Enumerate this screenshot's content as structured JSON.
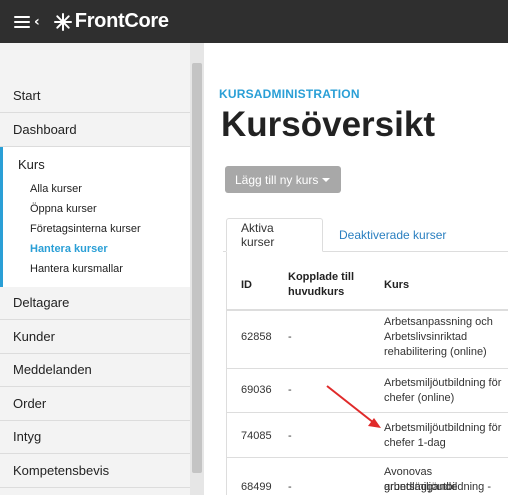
{
  "app": {
    "logo_text": "FrontCore"
  },
  "sidebar": {
    "items_top": [
      {
        "label": "Start"
      },
      {
        "label": "Dashboard"
      }
    ],
    "kurs": {
      "label": "Kurs",
      "subitems": [
        {
          "label": "Alla kurser"
        },
        {
          "label": "Öppna kurser"
        },
        {
          "label": "Företagsinterna kurser"
        },
        {
          "label": "Hantera kurser"
        },
        {
          "label": "Hantera kursmallar"
        }
      ]
    },
    "items_bottom": [
      {
        "label": "Deltagare"
      },
      {
        "label": "Kunder"
      },
      {
        "label": "Meddelanden"
      },
      {
        "label": "Order"
      },
      {
        "label": "Intyg"
      },
      {
        "label": "Kompetensbevis"
      }
    ]
  },
  "main": {
    "section_label": "KURSADMINISTRATION",
    "title": "Kursöversikt",
    "add_button": "Lägg till ny kurs",
    "tabs": [
      {
        "label": "Aktiva kurser"
      },
      {
        "label": "Deaktiverade kurser"
      }
    ],
    "table": {
      "headers": {
        "id": "ID",
        "linked_1": "Kopplade till",
        "linked_2": "huvudkurs",
        "course": "Kurs"
      },
      "rows": [
        {
          "id": "62858",
          "linked": "-",
          "course_1": "Arbetsanpassning och",
          "course_2": "Arbetslivsinriktad",
          "course_3": "rehabilitering (online)"
        },
        {
          "id": "69036",
          "linked": "-",
          "course_1": "Arbetsmiljöutbildning för",
          "course_2": "chefer (online)",
          "course_3": ""
        },
        {
          "id": "74085",
          "linked": "-",
          "course_1": "Arbetsmiljöutbildning för",
          "course_2": "chefer 1-dag",
          "course_3": ""
        },
        {
          "id": "68499",
          "linked": "-",
          "course_1": "Avonovas grundläggande",
          "course_2": "arbetsmiljöutbildning -",
          "course_3": ""
        }
      ]
    }
  },
  "colors": {
    "accent": "#2a9fd6",
    "topbar": "#2f2f2f",
    "arrow": "#e02a2a"
  }
}
